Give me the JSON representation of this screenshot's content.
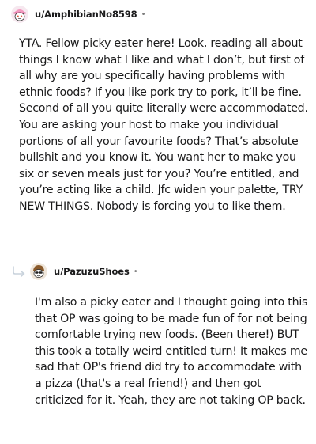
{
  "comments": [
    {
      "username": "u/AmphibianNo8598",
      "separator": "•",
      "avatar_icon": "snoo-avatar-pink-hat",
      "body": "YTA. Fellow picky eater here! Look, reading all about things I know what I like and what I don’t, but first of all why are you specifically having problems with ethnic foods? If you like pork try to pork, it’ll be fine. Second of all you quite literally were accommodated. You are asking your host to make you individual portions of all your favourite foods? That’s absolute bullshit and you know it. You want her to make you six or seven meals just for you? You’re entitled, and you’re acting like a child. Jfc widen your palette, TRY NEW THINGS. Nobody is forcing you to like them."
    },
    {
      "username": "u/PazuzuShoes",
      "separator": "•",
      "avatar_icon": "snoo-avatar-sunglasses",
      "reply_icon": "reply-arrow-icon",
      "body": "I'm also a picky eater and I thought going into this that OP was going to be made fun of for not being comfortable trying new foods. (Been there!) BUT this took a totally weird entitled turn! It makes me sad that OP's friend did try to accommodate with a pizza (that's a real friend!) and then got criticized for it. Yeah, they are not taking OP back."
    }
  ],
  "colors": {
    "text": "#1a1a1b",
    "meta": "#7c7c7c",
    "reply_arrow": "#c8d2dc"
  }
}
